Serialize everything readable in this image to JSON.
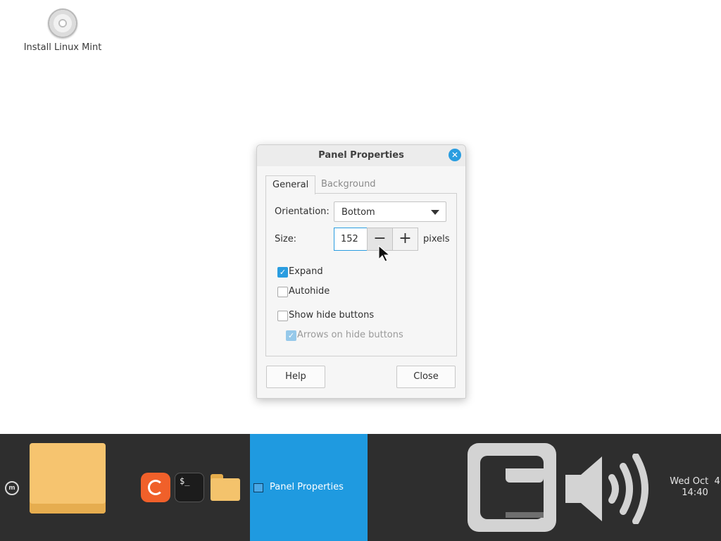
{
  "desktop": {
    "icons": [
      {
        "label": "Install Linux Mint",
        "icon": "disc-icon"
      }
    ]
  },
  "dialog": {
    "title": "Panel Properties",
    "close_icon": "close-icon",
    "tabs": [
      {
        "label": "General",
        "active": true
      },
      {
        "label": "Background",
        "active": false
      }
    ],
    "orientation": {
      "label": "Orientation:",
      "value": "Bottom"
    },
    "size": {
      "label": "Size:",
      "value": "152",
      "unit": "pixels",
      "minus": "−",
      "plus": "+"
    },
    "checkboxes": {
      "expand": {
        "label": "Expand",
        "checked": true
      },
      "autohide": {
        "label": "Autohide",
        "checked": false
      },
      "show_hide_buttons": {
        "label": "Show hide buttons",
        "checked": false
      },
      "arrows_on_hide_buttons": {
        "label": "Arrows on hide buttons",
        "checked": true,
        "enabled": false
      }
    },
    "buttons": {
      "help": "Help",
      "close": "Close"
    }
  },
  "panel": {
    "menu_icon": "linux-mint-menu-icon",
    "launchers": [
      "firefox-icon",
      "terminal-icon",
      "files-icon"
    ],
    "terminal_glyph": "$_",
    "taskbar": {
      "label": "Panel Properties",
      "active": true
    },
    "tray": [
      "network-icon",
      "volume-icon"
    ],
    "clock": {
      "date": "Wed Oct  4",
      "time": "14:40"
    }
  },
  "colors": {
    "accent": "#1f9ae0",
    "panel_bg": "#2e2e2e",
    "folder": "#f6c46f"
  }
}
